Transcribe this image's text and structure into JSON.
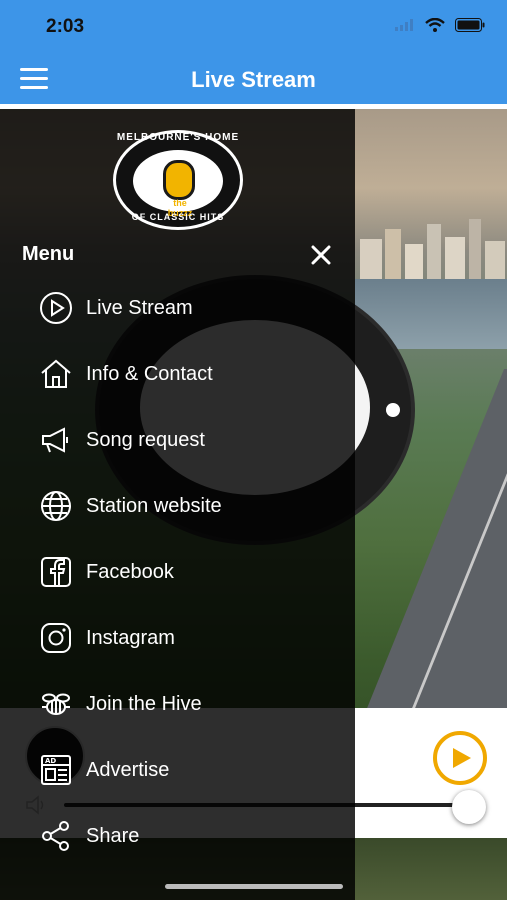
{
  "status_bar": {
    "time": "2:03"
  },
  "header": {
    "title": "Live Stream"
  },
  "logo": {
    "top_text": "MELBOURNE'S HOME",
    "bottom_text": "OF CLASSIC HITS",
    "brand": "the buzzz"
  },
  "drawer": {
    "title": "Menu",
    "items": [
      {
        "label": "Live Stream",
        "icon": "play-circle-icon"
      },
      {
        "label": "Info & Contact",
        "icon": "house-icon"
      },
      {
        "label": "Song request",
        "icon": "megaphone-icon"
      },
      {
        "label": "Station website",
        "icon": "globe-icon"
      },
      {
        "label": "Facebook",
        "icon": "facebook-icon"
      },
      {
        "label": "Instagram",
        "icon": "instagram-icon"
      },
      {
        "label": "Join the Hive",
        "icon": "bee-icon"
      },
      {
        "label": "Advertise",
        "icon": "ad-board-icon"
      },
      {
        "label": "Share",
        "icon": "share-icon"
      }
    ]
  },
  "player": {
    "volume": 0.97
  },
  "colors": {
    "header": "#3d95e8",
    "accent": "#f0a800"
  }
}
